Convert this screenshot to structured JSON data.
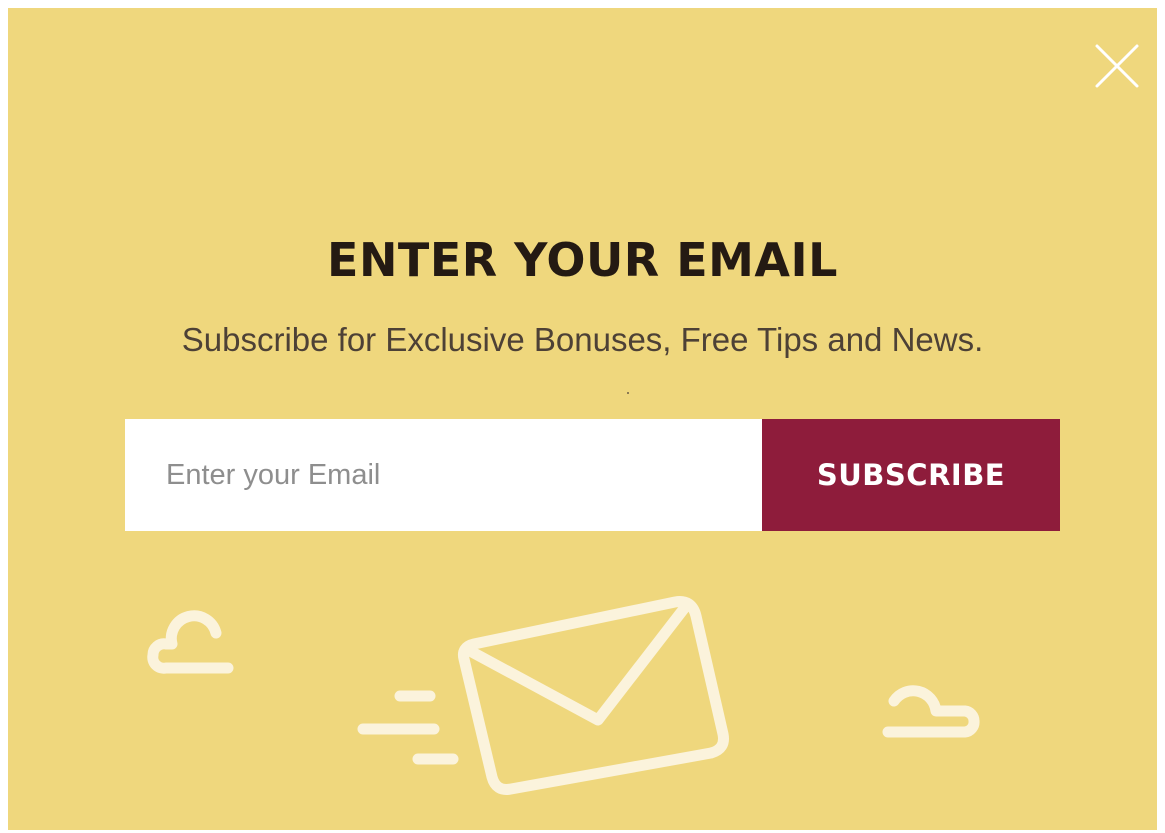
{
  "popup": {
    "headline": "ENTER YOUR EMAIL",
    "subheadline": "Subscribe for Exclusive Bonuses, Free Tips and News.",
    "close_icon": "close-icon",
    "email_field": {
      "value": "",
      "placeholder": "Enter your Email"
    },
    "subscribe_label": "SUBSCRIBE",
    "illustration_icons": [
      "cloud-icon",
      "envelope-icon",
      "speed-lines-icon",
      "cloud-icon"
    ]
  },
  "colors": {
    "background": "#efd77d",
    "headline": "#241a13",
    "subheadline": "#4d4136",
    "button": "#8e1c3b",
    "button_text": "#ffffff",
    "illustration": "#fbf3dc"
  }
}
